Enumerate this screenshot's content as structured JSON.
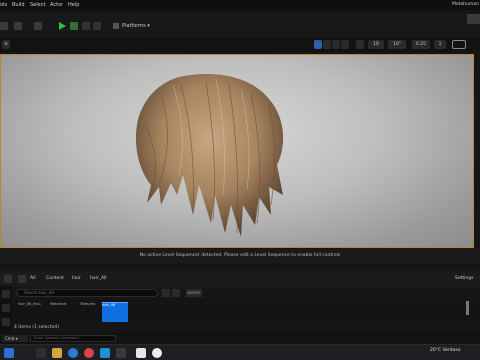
{
  "menu": {
    "items": [
      "ols",
      "Build",
      "Select",
      "Actor",
      "Help"
    ],
    "right_label": "Metahuman"
  },
  "toolbar": {
    "platforms_label": "Platforms"
  },
  "viewport": {
    "grid_value": "10",
    "angle_value": "10°",
    "scale_value": "0.25",
    "speed_value": "1"
  },
  "sequencer_notice": "No active Level Sequencer detected. Please edit a Level Sequence to enable full controls",
  "content_browser": {
    "path": [
      "All",
      "Content",
      "hair",
      "hair_All"
    ],
    "settings_label": "Settings",
    "search_placeholder": "Search hair_All",
    "import_label": "IMPORT",
    "items": [
      {
        "label": "hair_06_fbx1"
      },
      {
        "label": "Materials"
      },
      {
        "label": "Textures"
      },
      {
        "label": "hair_06",
        "selected": true
      }
    ],
    "status": "4 items (1 selected)"
  },
  "bottom_bar": {
    "cmd_label": "Cmd",
    "console_placeholder": "Enter Console Command"
  },
  "taskbar": {
    "temperature": "20°C",
    "weather": "Ventoso"
  },
  "colors": {
    "accent": "#d8a033",
    "selection": "#0f6fe0",
    "play": "#2fbf47"
  }
}
